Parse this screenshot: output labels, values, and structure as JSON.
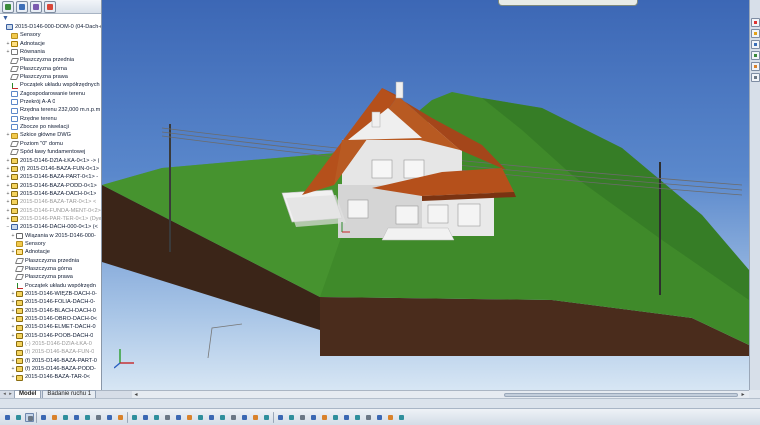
{
  "tree": {
    "filter_icon": "funnel-icon",
    "panel_tabs": [
      {
        "name": "featuremanager-tab",
        "color": "#3b8b3b"
      },
      {
        "name": "propertymanager-tab",
        "color": "#3d6fb8"
      },
      {
        "name": "configuration-tab",
        "color": "#7a5bb0"
      },
      {
        "name": "appearance-tab",
        "color": "#d8473a"
      }
    ],
    "items": [
      {
        "label": "2015-D146-000-DOM-0  (04-Dach-c",
        "indent": 0,
        "icon": "ic-asm",
        "tw": "",
        "suppressed": false
      },
      {
        "label": "Sensory",
        "indent": 1,
        "icon": "ic-folder",
        "tw": "",
        "suppressed": false
      },
      {
        "label": "Adnotacje",
        "indent": 1,
        "icon": "ic-annot",
        "tw": "+",
        "suppressed": false
      },
      {
        "label": "Równania",
        "indent": 1,
        "icon": "ic-sensor",
        "tw": "+",
        "suppressed": false
      },
      {
        "label": "Płaszczyzna przednia",
        "indent": 1,
        "icon": "ic-plane",
        "tw": "",
        "suppressed": false
      },
      {
        "label": "Płaszczyzna górna",
        "indent": 1,
        "icon": "ic-plane",
        "tw": "",
        "suppressed": false
      },
      {
        "label": "Płaszczyzna prawa",
        "indent": 1,
        "icon": "ic-plane",
        "tw": "",
        "suppressed": false
      },
      {
        "label": "Początek układu współrzędnych",
        "indent": 1,
        "icon": "ic-origin",
        "tw": "",
        "suppressed": false
      },
      {
        "label": "Zagospodarowanie terenu",
        "indent": 1,
        "icon": "ic-sketch",
        "tw": "",
        "suppressed": false
      },
      {
        "label": "Przekrój A-A 0",
        "indent": 1,
        "icon": "ic-sketch",
        "tw": "",
        "suppressed": false
      },
      {
        "label": "Rzędna terenu 232,000 m.n.p.m",
        "indent": 1,
        "icon": "ic-sketch",
        "tw": "",
        "suppressed": false
      },
      {
        "label": "Rzędne terenu",
        "indent": 1,
        "icon": "ic-sketch",
        "tw": "",
        "suppressed": false
      },
      {
        "label": "Zbocze po niwelacji",
        "indent": 1,
        "icon": "ic-sketch",
        "tw": "",
        "suppressed": false
      },
      {
        "label": "Szkice główne DWG",
        "indent": 1,
        "icon": "ic-folder",
        "tw": "+",
        "suppressed": false
      },
      {
        "label": "Poziom \"0\" domu",
        "indent": 1,
        "icon": "ic-plane",
        "tw": "",
        "suppressed": false
      },
      {
        "label": "Spód ławy fundamentowej",
        "indent": 1,
        "icon": "ic-plane",
        "tw": "",
        "suppressed": false
      },
      {
        "label": "2015-D146-DZIA-ŁKA-0<1> -> (",
        "indent": 1,
        "icon": "ic-part",
        "tw": "+",
        "suppressed": false
      },
      {
        "label": "(f) 2015-D146-BAZA-FUN-0<1>",
        "indent": 1,
        "icon": "ic-part",
        "tw": "+",
        "suppressed": false
      },
      {
        "label": "2015-D146-BAZA-PART-0<1> -",
        "indent": 1,
        "icon": "ic-part",
        "tw": "+",
        "suppressed": false
      },
      {
        "label": "2015-D146-BAZA-PODD-0<1>",
        "indent": 1,
        "icon": "ic-part",
        "tw": "+",
        "suppressed": false
      },
      {
        "label": "2015-D146-BAZA-DACH-0<1>",
        "indent": 1,
        "icon": "ic-part",
        "tw": "+",
        "suppressed": false
      },
      {
        "label": "2015-D146-BAZA-TAR-0<1> <",
        "indent": 1,
        "icon": "ic-part",
        "tw": "+",
        "suppressed": true
      },
      {
        "label": "2015-D146-FUNDA-MENT-0<2>",
        "indent": 1,
        "icon": "ic-part",
        "tw": "+",
        "suppressed": true
      },
      {
        "label": "2015-D146-PAR-TER-0<1> (Dye",
        "indent": 1,
        "icon": "ic-part",
        "tw": "+",
        "suppressed": true
      },
      {
        "label": "2015-D146-DACH-000-0<1> (<",
        "indent": 1,
        "icon": "ic-asm",
        "tw": "−",
        "suppressed": false
      },
      {
        "label": "Wiązania w 2015-D146-000-",
        "indent": 2,
        "icon": "ic-mate",
        "tw": "+",
        "suppressed": false
      },
      {
        "label": "Sensory",
        "indent": 2,
        "icon": "ic-folder",
        "tw": "",
        "suppressed": false
      },
      {
        "label": "Adnotacje",
        "indent": 2,
        "icon": "ic-annot",
        "tw": "+",
        "suppressed": false
      },
      {
        "label": "Płaszczyzna przednia",
        "indent": 2,
        "icon": "ic-plane",
        "tw": "",
        "suppressed": false
      },
      {
        "label": "Płaszczyzna górna",
        "indent": 2,
        "icon": "ic-plane",
        "tw": "",
        "suppressed": false
      },
      {
        "label": "Płaszczyzna prawa",
        "indent": 2,
        "icon": "ic-plane",
        "tw": "",
        "suppressed": false
      },
      {
        "label": "Początek układu współrzędn",
        "indent": 2,
        "icon": "ic-origin",
        "tw": "",
        "suppressed": false
      },
      {
        "label": "2015-D146-WIĘZB-DACH-0-",
        "indent": 2,
        "icon": "ic-part",
        "tw": "+",
        "suppressed": false
      },
      {
        "label": "2015-D146-FOLIA-DACH-0-",
        "indent": 2,
        "icon": "ic-part",
        "tw": "+",
        "suppressed": false
      },
      {
        "label": "2015-D146-BLACH-DACH-0",
        "indent": 2,
        "icon": "ic-part",
        "tw": "+",
        "suppressed": false
      },
      {
        "label": "2015-D146-OBRO-DACH-0<",
        "indent": 2,
        "icon": "ic-part",
        "tw": "+",
        "suppressed": false
      },
      {
        "label": "2015-D146-ELMET-DACH-0",
        "indent": 2,
        "icon": "ic-part",
        "tw": "+",
        "suppressed": false
      },
      {
        "label": "2015-D146-POOB-DACH-0",
        "indent": 2,
        "icon": "ic-part",
        "tw": "+",
        "suppressed": false
      },
      {
        "label": "(-) 2015-D146-DZIA-ŁKA-0",
        "indent": 2,
        "icon": "ic-part",
        "tw": "",
        "suppressed": true
      },
      {
        "label": "(f) 2015-D146-BAZA-FUN-0",
        "indent": 2,
        "icon": "ic-part",
        "tw": "",
        "suppressed": true
      },
      {
        "label": "(f) 2015-D146-BAZA-PART-0",
        "indent": 2,
        "icon": "ic-part",
        "tw": "+",
        "suppressed": false
      },
      {
        "label": "(f) 2015-D146-BAZA-PODD-",
        "indent": 2,
        "icon": "ic-part",
        "tw": "+",
        "suppressed": false
      },
      {
        "label": "2015-D146-BAZA-TAR-0<",
        "indent": 2,
        "icon": "ic-part",
        "tw": "+",
        "suppressed": false
      }
    ]
  },
  "viewport": {
    "background_top": "#3c67b5",
    "background_bottom": "#d7e6f4",
    "grass_color": "#3f8a2a",
    "soil_color": "#3a2418",
    "roof_color": "#b5501b",
    "wall_color": "#e4e4e4"
  },
  "tabs": {
    "model": "Model",
    "motion_study": "Badanie ruchu 1"
  },
  "toolbar": {
    "buttons": [
      "rotate-view-icon",
      "zoom-to-fit-icon",
      "select-icon",
      "zoom-area-icon",
      "section-view-icon",
      "view-orientation-icon",
      "display-style-icon",
      "hide-show-icon",
      "edit-appearance-icon",
      "apply-scene-icon",
      "view-settings-icon",
      "mate-icon",
      "smart-fastener-icon",
      "move-component-icon",
      "rotate-component-icon",
      "exploded-view-icon",
      "interference-icon",
      "measure-icon",
      "mass-properties-icon",
      "bill-of-materials-icon",
      "reference-geometry-icon",
      "instant3d-icon",
      "assembly-features-icon",
      "linear-pattern-icon",
      "insert-component-icon",
      "new-part-icon",
      "new-assembly-icon",
      "copy-with-mates-icon",
      "hide-components-icon",
      "change-transparency-icon",
      "edit-component-icon",
      "no-external-references-icon",
      "large-assembly-mode-icon",
      "show-hidden-icon",
      "rebuild-icon",
      "options-icon"
    ]
  },
  "task_pane": {
    "buttons": [
      "solidworks-resources-icon",
      "design-library-icon",
      "file-explorer-icon",
      "view-palette-icon",
      "appearances-icon",
      "custom-properties-icon"
    ]
  }
}
